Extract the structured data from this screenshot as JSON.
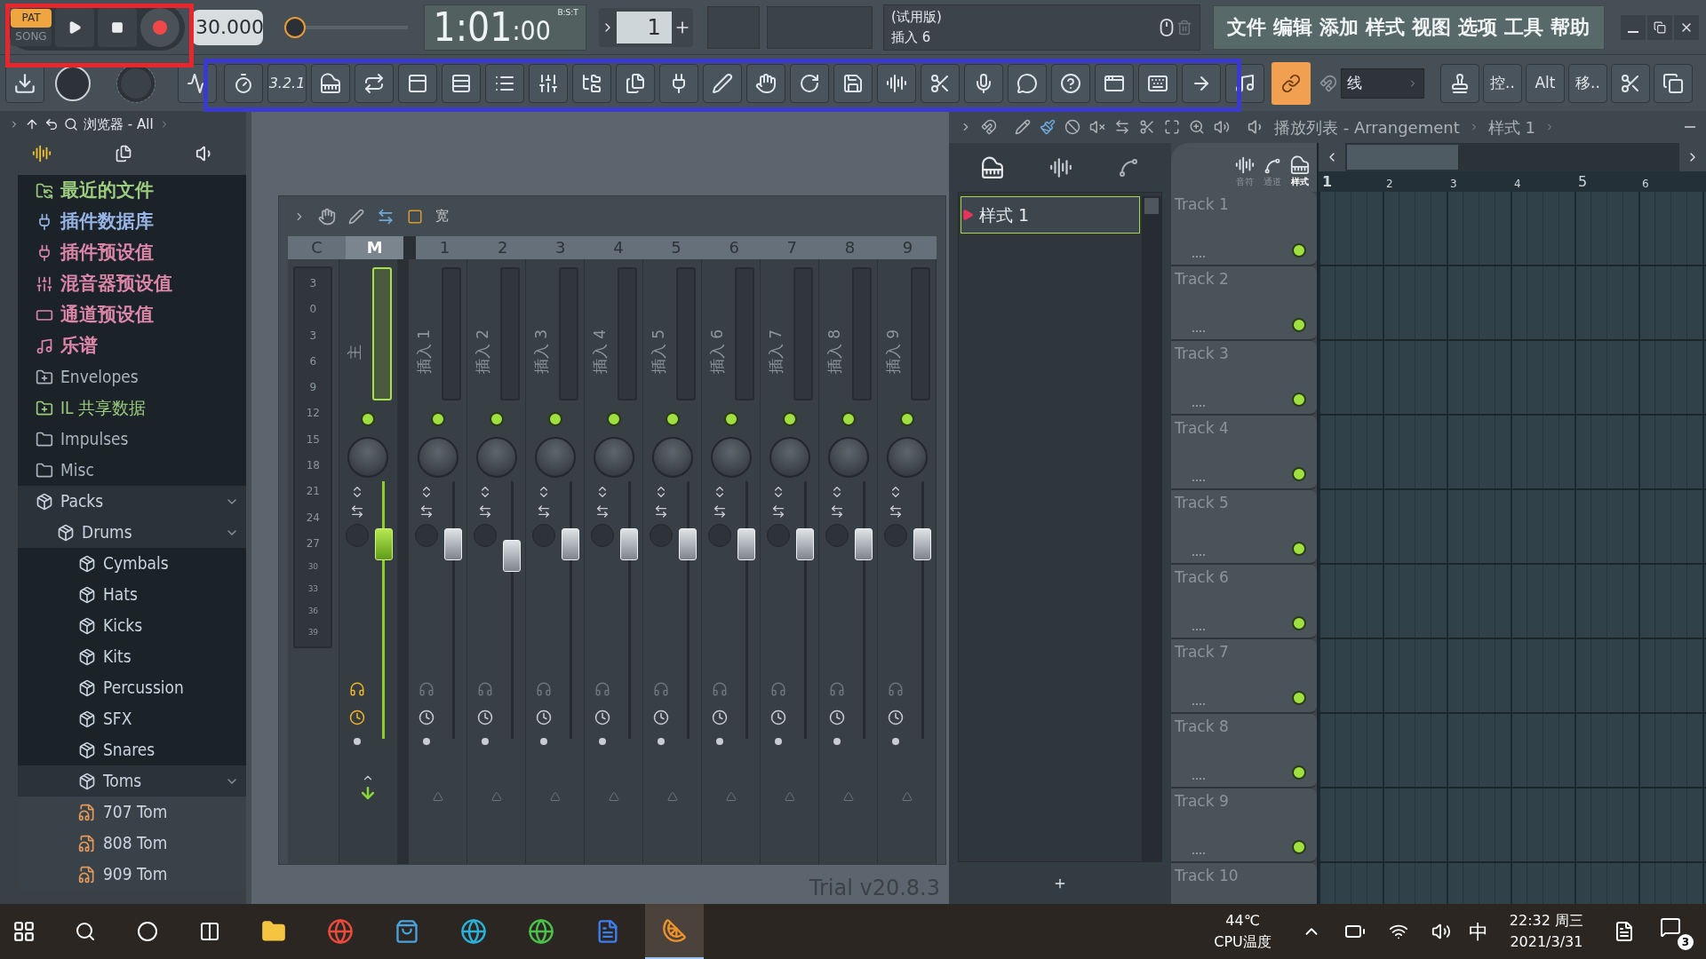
{
  "transport": {
    "modes": [
      {
        "label": "PAT",
        "selected": true
      },
      {
        "label": "SONG",
        "selected": false
      }
    ],
    "tempo": "30.000",
    "pitch_slider": {
      "level": 0
    },
    "time": "1:01",
    "time_ticks": ":00",
    "time_format": "B:S:T",
    "pattern_number": "1"
  },
  "hint": {
    "line1": "(试用版)",
    "line2": "插入 6"
  },
  "menu": [
    "文件",
    "编辑",
    "添加",
    "样式",
    "视图",
    "选项",
    "工具",
    "帮助"
  ],
  "toolbar": {
    "countdown": "3.2.1",
    "snap": "线",
    "buttons": [
      "控..",
      "Alt",
      "移.."
    ]
  },
  "browser": {
    "title": "浏览器 - All",
    "items": [
      {
        "label": "最近的文件",
        "kind": "recent"
      },
      {
        "label": "插件数据库",
        "kind": "plugin-db"
      },
      {
        "label": "插件预设值",
        "kind": "plugin-preset"
      },
      {
        "label": "混音器预设值",
        "kind": "mixer-preset"
      },
      {
        "label": "通道预设值",
        "kind": "channel-preset"
      },
      {
        "label": "乐谱",
        "kind": "score"
      },
      {
        "label": "Envelopes",
        "kind": "user-folder"
      },
      {
        "label": "IL 共享数据",
        "kind": "shared-folder"
      },
      {
        "label": "Impulses",
        "kind": "folder"
      },
      {
        "label": "Misc",
        "kind": "folder"
      },
      {
        "label": "Packs",
        "kind": "pack",
        "expanded": true,
        "children": [
          {
            "label": "Drums",
            "kind": "pack",
            "expanded": true,
            "children": [
              {
                "label": "Cymbals",
                "kind": "pack",
                "expanded": false
              },
              {
                "label": "Hats",
                "kind": "pack",
                "expanded": false
              },
              {
                "label": "Kicks",
                "kind": "pack",
                "expanded": false
              },
              {
                "label": "Kits",
                "kind": "pack",
                "expanded": false
              },
              {
                "label": "Percussion",
                "kind": "pack",
                "expanded": false
              },
              {
                "label": "SFX",
                "kind": "pack",
                "expanded": false
              },
              {
                "label": "Snares",
                "kind": "pack",
                "expanded": false
              },
              {
                "label": "Toms",
                "kind": "pack",
                "expanded": true,
                "children": [
                  {
                    "label": "707 Tom",
                    "kind": "sample"
                  },
                  {
                    "label": "808 Tom",
                    "kind": "sample"
                  },
                  {
                    "label": "909 Tom",
                    "kind": "sample"
                  }
                ]
              }
            ]
          }
        ]
      }
    ]
  },
  "mixer": {
    "toolbar_label": "宽",
    "scale_header": "C",
    "scale": [
      "3",
      "0",
      "3",
      "6",
      "9",
      "12",
      "15",
      "18",
      "21",
      "24",
      "27",
      "30",
      "33",
      "36",
      "39"
    ],
    "strips": [
      {
        "header": "M",
        "label": "主",
        "selected": true,
        "level": 0.79
      },
      {
        "header": "1",
        "label": "插入 1",
        "selected": false,
        "level": 0.79
      },
      {
        "header": "2",
        "label": "插入 2",
        "selected": false,
        "level": 0.74
      },
      {
        "header": "3",
        "label": "插入 3",
        "selected": false,
        "level": 0.79
      },
      {
        "header": "4",
        "label": "插入 4",
        "selected": false,
        "level": 0.79
      },
      {
        "header": "5",
        "label": "插入 5",
        "selected": false,
        "level": 0.79
      },
      {
        "header": "6",
        "label": "插入 6",
        "selected": false,
        "level": 0.79
      },
      {
        "header": "7",
        "label": "插入 7",
        "selected": false,
        "level": 0.79
      },
      {
        "header": "8",
        "label": "插入 8",
        "selected": false,
        "level": 0.79
      },
      {
        "header": "9",
        "label": "插入 9",
        "selected": false,
        "level": 0.79
      }
    ]
  },
  "version": "Trial v20.8.3",
  "patterns": {
    "items": [
      {
        "label": "样式 1",
        "selected": true
      }
    ]
  },
  "playlist": {
    "title": "播放列表 - Arrangement",
    "pattern": "样式 1",
    "tabs": [
      {
        "label": "音符",
        "selected": false
      },
      {
        "label": "通道",
        "selected": false
      },
      {
        "label": "样式",
        "selected": true
      }
    ],
    "bars": [
      "1",
      "2",
      "3",
      "4",
      "5",
      "6"
    ],
    "tracks": [
      "Track 1",
      "Track 2",
      "Track 3",
      "Track 4",
      "Track 5",
      "Track 6",
      "Track 7",
      "Track 8",
      "Track 9",
      "Track 10"
    ]
  },
  "taskbar": {
    "temperature": "44℃",
    "temperature_label": "CPU温度",
    "ime": "中",
    "time": "22:32 周三",
    "date": "2021/3/31",
    "notifications": "3"
  }
}
